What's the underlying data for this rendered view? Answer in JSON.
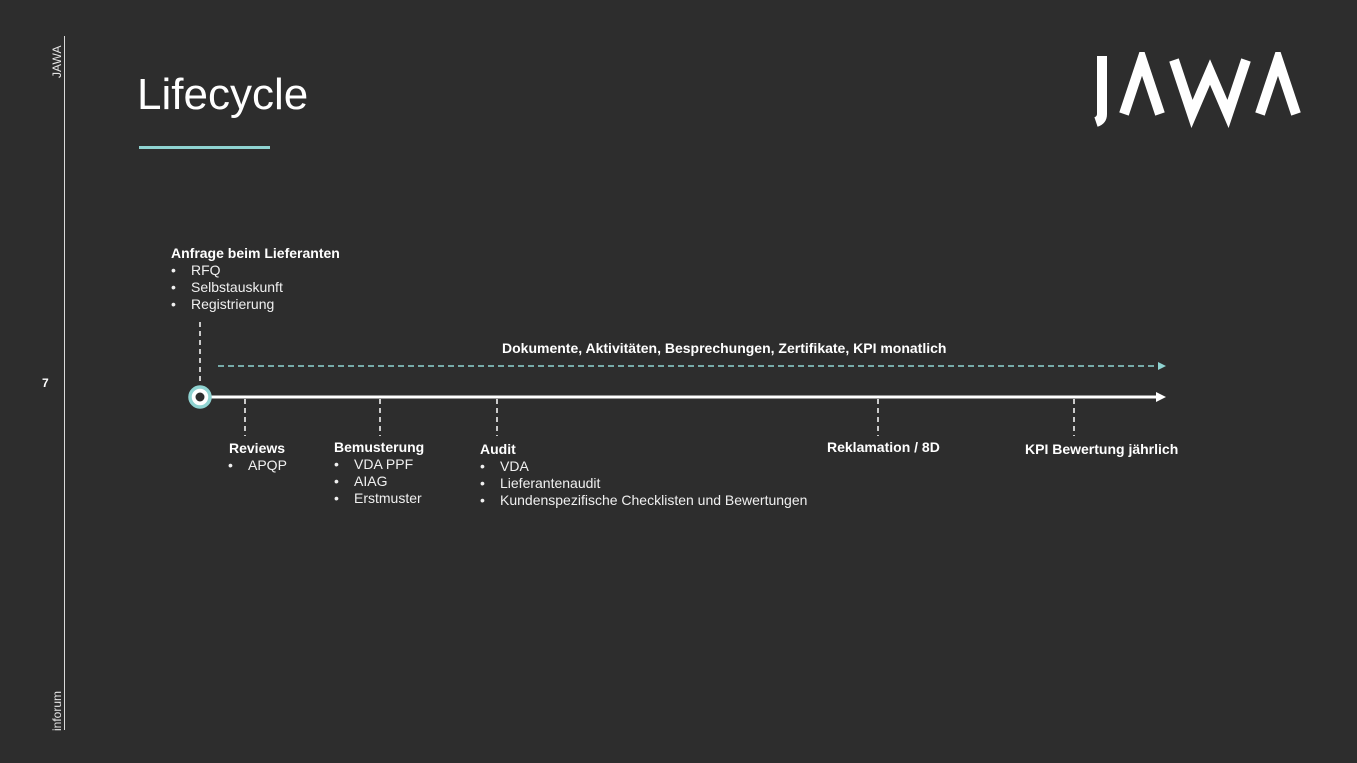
{
  "side": {
    "top_label": "JAWA",
    "bottom_label": "inforum",
    "page_number": "7"
  },
  "slide": {
    "title": "Lifecycle"
  },
  "logo": {
    "text": "JAWA",
    "color": "#ffffff"
  },
  "colors": {
    "accent": "#8fd3d1",
    "background": "#2d2d2d",
    "text": "#ffffff"
  },
  "timeline": {
    "continuous_label": "Dokumente, Aktivitäten, Besprechungen, Zertifikate,  KPI monatlich",
    "start": {
      "title": "Anfrage beim Lieferanten",
      "items": [
        "RFQ",
        "Selbstauskunft",
        "Registrierung"
      ]
    },
    "milestones": [
      {
        "title": "Reviews",
        "items": [
          "APQP"
        ]
      },
      {
        "title": "Bemusterung",
        "items": [
          "VDA PPF",
          "AIAG",
          "Erstmuster"
        ]
      },
      {
        "title": "Audit",
        "items": [
          "VDA",
          "Lieferantenaudit",
          "Kundenspezifische Checklisten und Bewertungen"
        ]
      },
      {
        "title": "Reklamation / 8D",
        "items": []
      },
      {
        "title": "KPI Bewertung jährlich",
        "items": []
      }
    ]
  }
}
